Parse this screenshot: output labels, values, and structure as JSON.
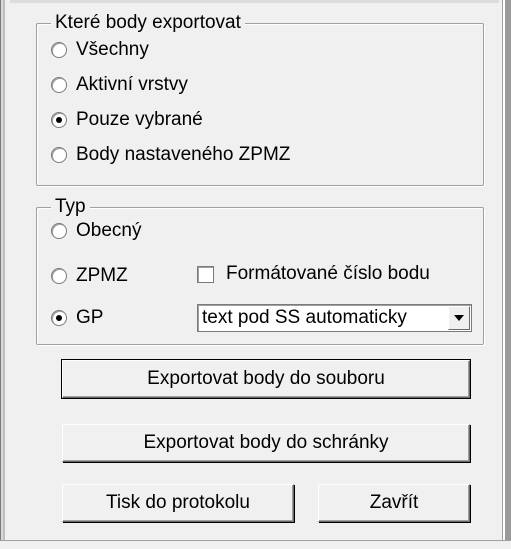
{
  "export_group": {
    "title": "Které body exportovat",
    "options": [
      {
        "label": "Všechny",
        "checked": false
      },
      {
        "label": "Aktivní vrstvy",
        "checked": false
      },
      {
        "label": "Pouze vybrané",
        "checked": true
      },
      {
        "label": "Body nastaveného ZPMZ",
        "checked": false
      }
    ]
  },
  "type_group": {
    "title": "Typ",
    "options": [
      {
        "label": "Obecný",
        "checked": false
      },
      {
        "label": "ZPMZ",
        "checked": false
      },
      {
        "label": "GP",
        "checked": true
      }
    ],
    "checkbox_label": "Formátované číslo bodu",
    "checkbox_checked": false,
    "combo_value": "text pod SS automaticky"
  },
  "buttons": {
    "export_file": "Exportovat body do souboru",
    "export_clipboard": "Exportovat body do schránky",
    "print_protocol": "Tisk do protokolu",
    "close": "Zavřít"
  }
}
